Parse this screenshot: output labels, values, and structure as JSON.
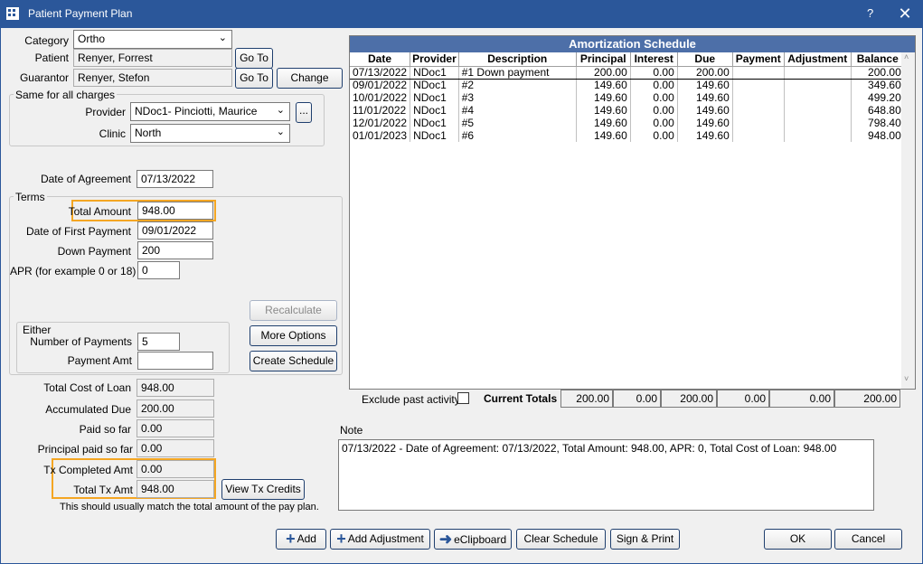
{
  "window": {
    "title": "Patient Payment Plan",
    "help": "?",
    "close": "✕"
  },
  "form": {
    "category_label": "Category",
    "category_value": "Ortho",
    "patient_label": "Patient",
    "patient_value": "Renyer, Forrest",
    "guarantor_label": "Guarantor",
    "guarantor_value": "Renyer, Stefon",
    "goto_label": "Go To",
    "change_label": "Change",
    "same_group": "Same for all charges",
    "provider_label": "Provider",
    "provider_value": "NDoc1- Pinciotti, Maurice",
    "provider_pick": "...",
    "clinic_label": "Clinic",
    "clinic_value": "North",
    "date_agreement_label": "Date of Agreement",
    "date_agreement_value": "07/13/2022",
    "terms_group": "Terms",
    "total_amount_label": "Total Amount",
    "total_amount_value": "948.00",
    "date_first_label": "Date of First Payment",
    "date_first_value": "09/01/2022",
    "down_payment_label": "Down Payment",
    "down_payment_value": "200",
    "apr_label": "APR (for example 0 or 18)",
    "apr_value": "0",
    "either_group": "Either",
    "num_payments_label": "Number of Payments",
    "num_payments_value": "5",
    "payment_amt_label": "Payment Amt",
    "payment_amt_value": "",
    "recalculate": "Recalculate",
    "more_options": "More Options",
    "create_schedule": "Create Schedule",
    "total_cost_label": "Total Cost of Loan",
    "total_cost_value": "948.00",
    "accumulated_label": "Accumulated Due",
    "accumulated_value": "200.00",
    "paid_label": "Paid so far",
    "paid_value": "0.00",
    "principal_paid_label": "Principal paid so far",
    "principal_paid_value": "0.00",
    "tx_completed_label": "Tx Completed Amt",
    "tx_completed_value": "0.00",
    "total_tx_label": "Total Tx Amt",
    "total_tx_value": "948.00",
    "view_tx_credits": "View Tx Credits",
    "match_note": "This should usually match the total amount of the pay plan."
  },
  "schedule": {
    "title": "Amortization Schedule",
    "columns": [
      "Date",
      "Provider",
      "Description",
      "Principal",
      "Interest",
      "Due",
      "Payment",
      "Adjustment",
      "Balance"
    ],
    "rows": [
      [
        "07/13/2022",
        "NDoc1",
        "#1 Down payment",
        "200.00",
        "0.00",
        "200.00",
        "",
        "",
        "200.00"
      ],
      [
        "09/01/2022",
        "NDoc1",
        "#2",
        "149.60",
        "0.00",
        "149.60",
        "",
        "",
        "349.60"
      ],
      [
        "10/01/2022",
        "NDoc1",
        "#3",
        "149.60",
        "0.00",
        "149.60",
        "",
        "",
        "499.20"
      ],
      [
        "11/01/2022",
        "NDoc1",
        "#4",
        "149.60",
        "0.00",
        "149.60",
        "",
        "",
        "648.80"
      ],
      [
        "12/01/2022",
        "NDoc1",
        "#5",
        "149.60",
        "0.00",
        "149.60",
        "",
        "",
        "798.40"
      ],
      [
        "01/01/2023",
        "NDoc1",
        "#6",
        "149.60",
        "0.00",
        "149.60",
        "",
        "",
        "948.00"
      ]
    ]
  },
  "totals": {
    "exclude_label": "Exclude past activity",
    "current_label": "Current Totals",
    "values": [
      "200.00",
      "0.00",
      "200.00",
      "0.00",
      "0.00",
      "200.00"
    ]
  },
  "note": {
    "label": "Note",
    "text": "07/13/2022 - Date of Agreement: 07/13/2022, Total Amount: 948.00, APR: 0, Total Cost of Loan: 948.00"
  },
  "buttons": {
    "add": "Add",
    "add_adjustment": "Add Adjustment",
    "eclipboard": "eClipboard",
    "clear_schedule": "Clear Schedule",
    "sign_print": "Sign & Print",
    "ok": "OK",
    "cancel": "Cancel"
  },
  "colors": {
    "titlebar": "#2b579a",
    "highlight": "#f4a623",
    "grid_header": "#4d6fa8"
  }
}
